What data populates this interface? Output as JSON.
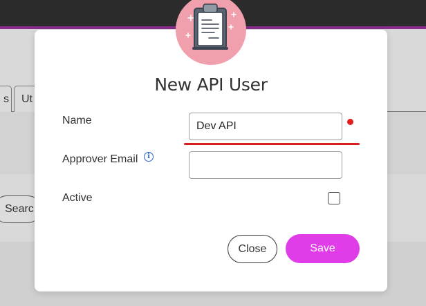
{
  "background": {
    "tabs": [
      "s",
      "Ut"
    ],
    "search_button_label": "Searc"
  },
  "modal": {
    "icon": "clipboard-icon",
    "title": "New API User",
    "fields": {
      "name": {
        "label": "Name",
        "value": "Dev API",
        "required": true,
        "error": true
      },
      "approver_email": {
        "label": "Approver Email",
        "value": "",
        "info_icon": "info-icon"
      },
      "active": {
        "label": "Active",
        "checked": false
      }
    },
    "buttons": {
      "close_label": "Close",
      "save_label": "Save"
    }
  },
  "colors": {
    "accent": "#e03ce8",
    "topbar": "#2b2b2b",
    "topbar_accent": "#8a2b8a",
    "icon_circle": "#f0a0ac",
    "error": "#d81e1e",
    "info": "#2a62c9"
  }
}
